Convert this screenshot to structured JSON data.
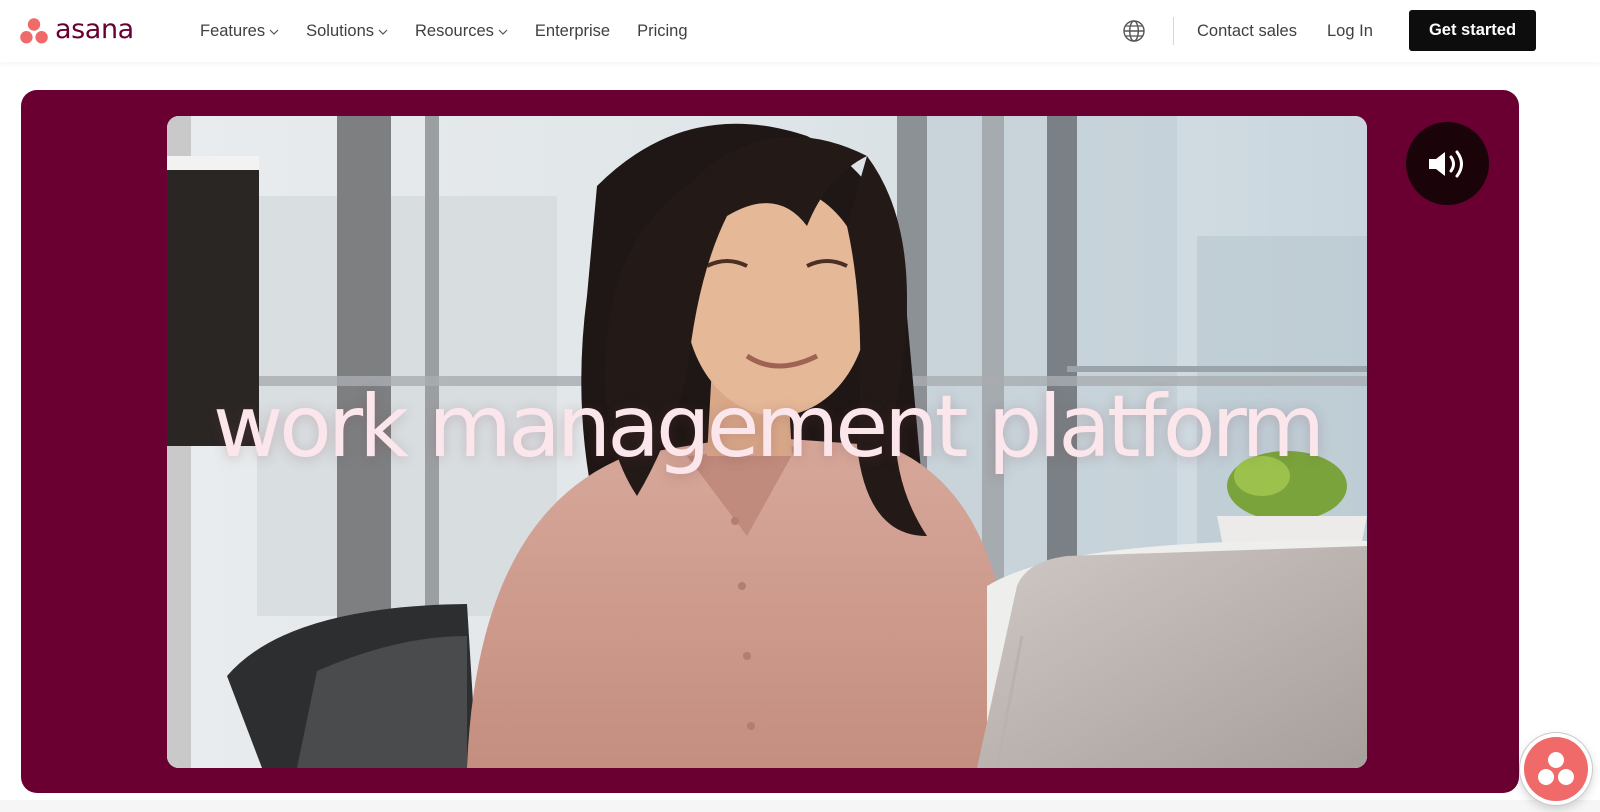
{
  "brand": {
    "name": "asana",
    "color": "#690031",
    "dot_color": "#f06a6a"
  },
  "nav": {
    "items": [
      {
        "label": "Features",
        "has_dropdown": true
      },
      {
        "label": "Solutions",
        "has_dropdown": true
      },
      {
        "label": "Resources",
        "has_dropdown": true
      },
      {
        "label": "Enterprise",
        "has_dropdown": false
      },
      {
        "label": "Pricing",
        "has_dropdown": false
      }
    ]
  },
  "header_right": {
    "language_icon": "globe-icon",
    "contact_sales": "Contact sales",
    "log_in": "Log In",
    "get_started": "Get started"
  },
  "hero": {
    "background_color": "#690031",
    "video_caption": "work management platform",
    "sound_icon": "speaker-sound-on-icon"
  },
  "widget": {
    "icon": "asana-dots-icon",
    "color": "#f06a6a"
  }
}
